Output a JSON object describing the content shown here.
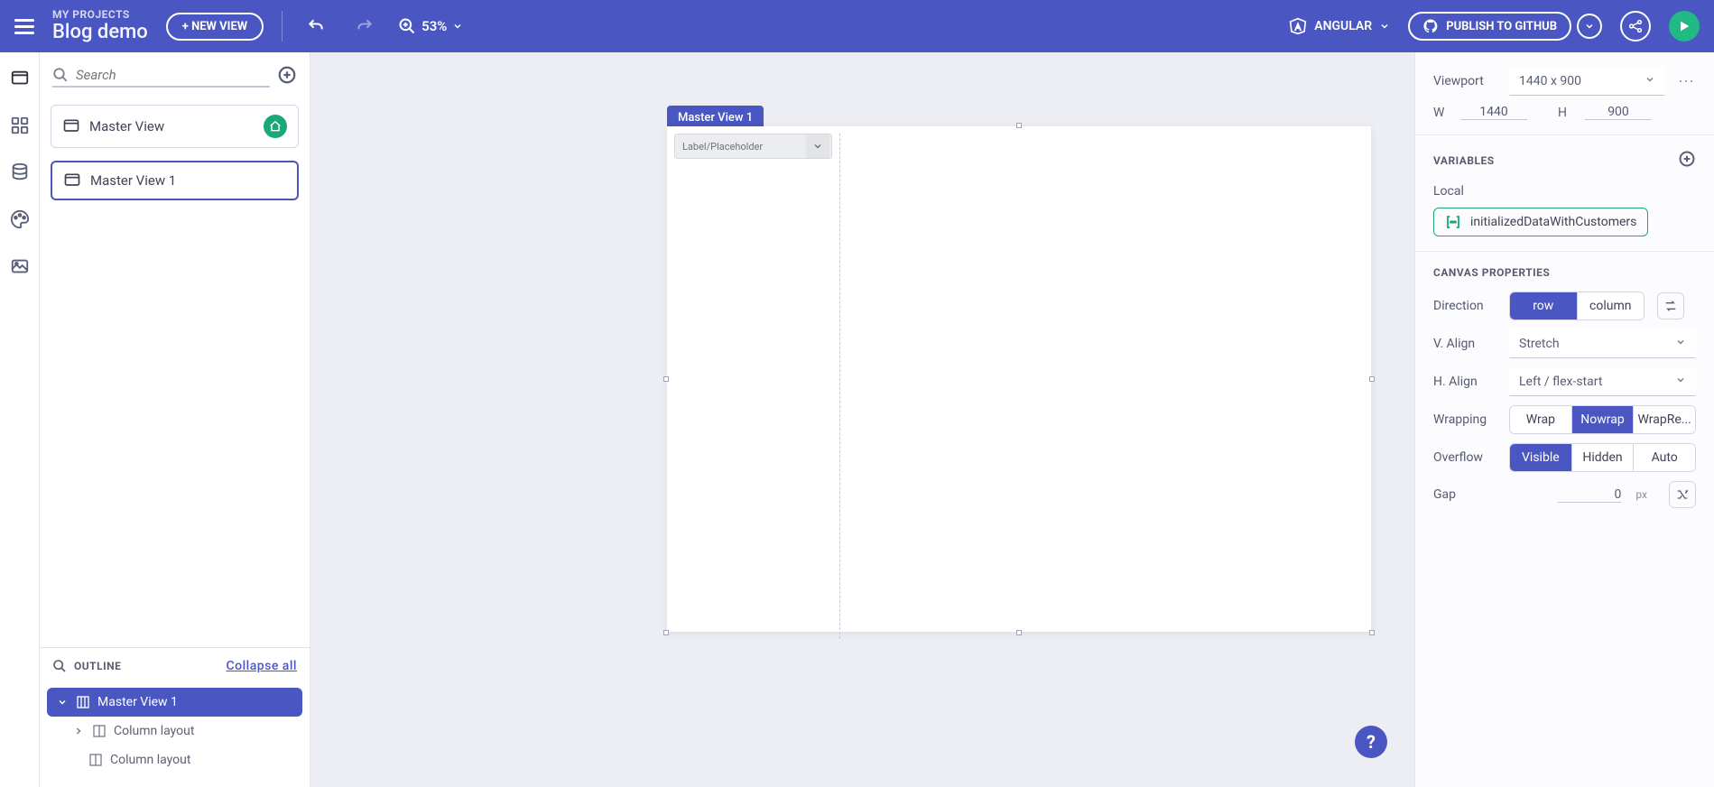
{
  "header": {
    "projects_label": "MY PROJECTS",
    "project_name": "Blog demo",
    "new_view_btn": "+ NEW VIEW",
    "zoom": "53%",
    "framework": "ANGULAR",
    "publish_btn": "PUBLISH TO GITHUB"
  },
  "sidebar": {
    "search_placeholder": "Search",
    "views": [
      {
        "label": "Master View",
        "home": true,
        "selected": false
      },
      {
        "label": "Master View 1",
        "home": false,
        "selected": true
      }
    ],
    "outline_title": "OUTLINE",
    "collapse_all": "Collapse all",
    "tree": {
      "root": "Master View 1",
      "child1": "Column layout",
      "child2": "Column layout"
    }
  },
  "canvas": {
    "tab_label": "Master View 1",
    "placeholder_label": "Label/Placeholder"
  },
  "right": {
    "viewport": {
      "label": "Viewport",
      "selected": "1440 x 900",
      "w_label": "W",
      "w_value": "1440",
      "h_label": "H",
      "h_value": "900"
    },
    "variables": {
      "title": "VARIABLES",
      "scope": "Local",
      "chip": "initializedDataWithCustomers"
    },
    "canvas_props": {
      "title": "CANVAS PROPERTIES",
      "direction_label": "Direction",
      "direction_opts": [
        "row",
        "column"
      ],
      "direction_active": "row",
      "valign_label": "V. Align",
      "valign_value": "Stretch",
      "halign_label": "H. Align",
      "halign_value": "Left / flex-start",
      "wrapping_label": "Wrapping",
      "wrapping_opts": [
        "Wrap",
        "Nowrap",
        "WrapRe..."
      ],
      "wrapping_active": "Nowrap",
      "overflow_label": "Overflow",
      "overflow_opts": [
        "Visible",
        "Hidden",
        "Auto"
      ],
      "overflow_active": "Visible",
      "gap_label": "Gap",
      "gap_value": "0",
      "gap_unit": "px"
    }
  },
  "help": "?"
}
